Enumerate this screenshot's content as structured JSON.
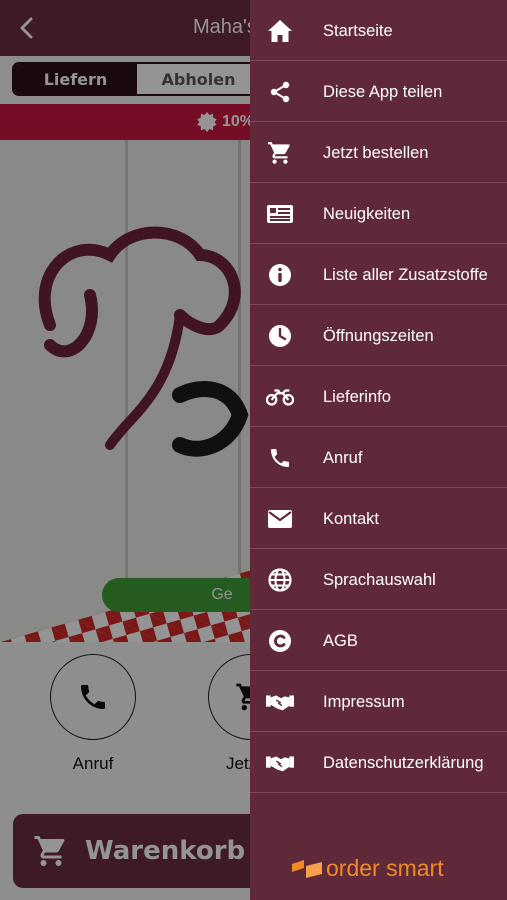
{
  "header": {
    "title": "Maha's"
  },
  "order_mode": {
    "active": "Liefern",
    "inactive": "Abholen"
  },
  "promo": {
    "text": "10%"
  },
  "hero": {
    "status_pill": "Ge"
  },
  "actions": [
    {
      "label": "Anruf",
      "icon": "phone-icon"
    },
    {
      "label": "Jetzt b",
      "icon": "cart-icon"
    }
  ],
  "cart": {
    "label": "Warenkorb"
  },
  "menu": {
    "items": [
      {
        "label": "Startseite",
        "icon": "home-icon"
      },
      {
        "label": "Diese App teilen",
        "icon": "share-icon"
      },
      {
        "label": "Jetzt bestellen",
        "icon": "cart-icon"
      },
      {
        "label": "Neuigkeiten",
        "icon": "news-icon"
      },
      {
        "label": "Liste aller Zusatzstoffe",
        "icon": "info-icon"
      },
      {
        "label": "Öffnungszeiten",
        "icon": "clock-icon"
      },
      {
        "label": "Lieferinfo",
        "icon": "motorbike-icon"
      },
      {
        "label": "Anruf",
        "icon": "phone-icon"
      },
      {
        "label": "Kontakt",
        "icon": "mail-icon"
      },
      {
        "label": "Sprachauswahl",
        "icon": "globe-icon"
      },
      {
        "label": "AGB",
        "icon": "copyright-icon"
      },
      {
        "label": "Impressum",
        "icon": "handshake-icon"
      },
      {
        "label": "Datenschutzerklärung",
        "icon": "handshake-icon"
      }
    ],
    "brand": "order smart"
  },
  "colors": {
    "primary": "#6c2d3f",
    "drawer": "#60293a",
    "promo": "#cc1744",
    "open_status": "#3f9e36",
    "brand_orange": "#f08a24"
  }
}
